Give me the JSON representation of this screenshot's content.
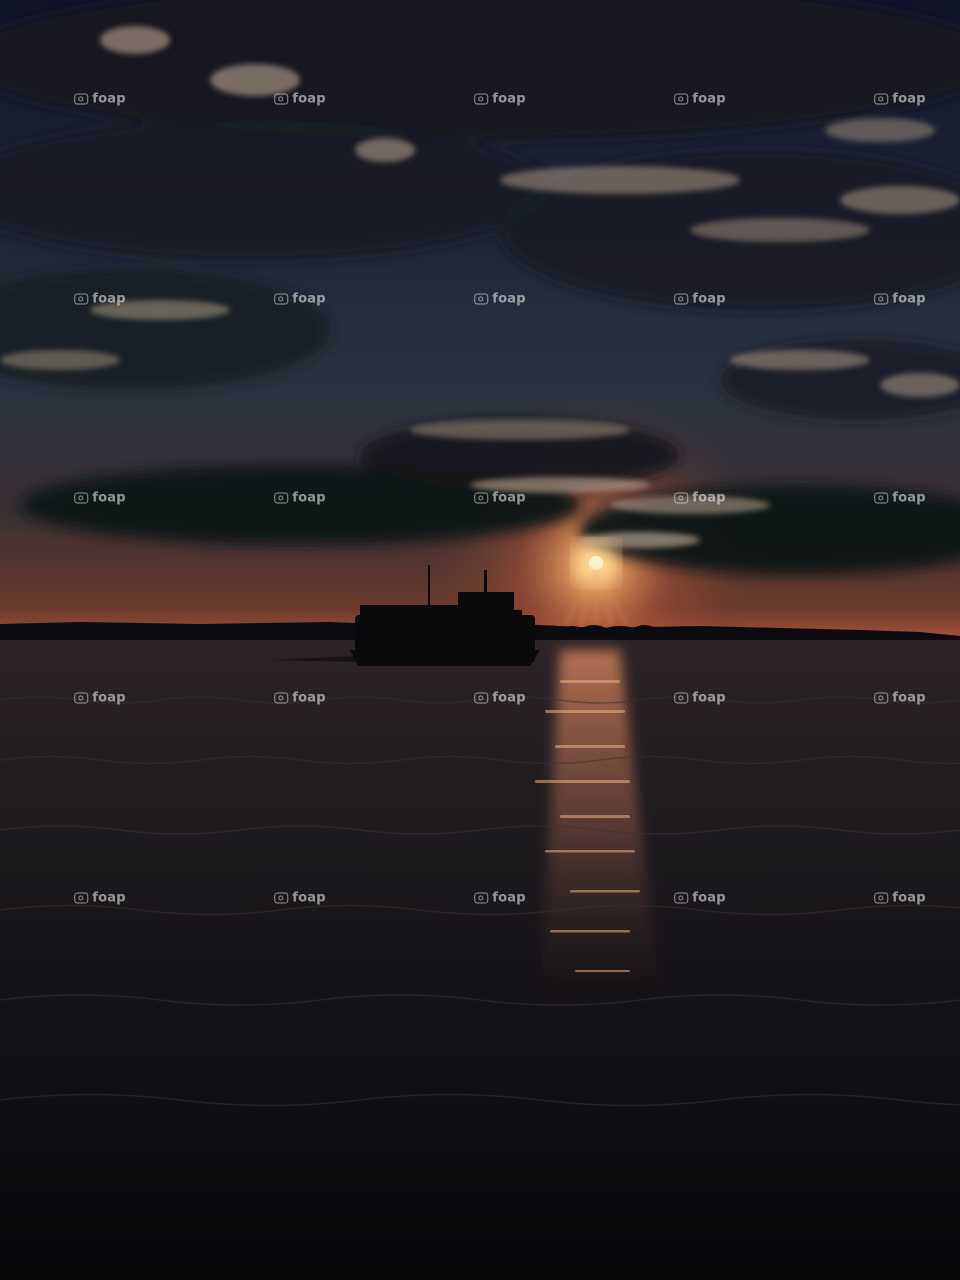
{
  "photo": {
    "scene": "sunset over water with boat silhouette",
    "colors": {
      "sky_top": "#15182a",
      "sky_mid": "#2a3342",
      "sky_low": "#4a3a3a",
      "horizon_glow": "#c8603a",
      "sun": "#ffd08a",
      "cloud_dark": "#1a1c24",
      "cloud_highlight": "#c9b39a",
      "water_top": "#2a2226",
      "water_bottom": "#0a0a0d",
      "shore": "#0d0c10"
    }
  },
  "watermark": {
    "text": "foap",
    "icon": "camera-icon"
  }
}
